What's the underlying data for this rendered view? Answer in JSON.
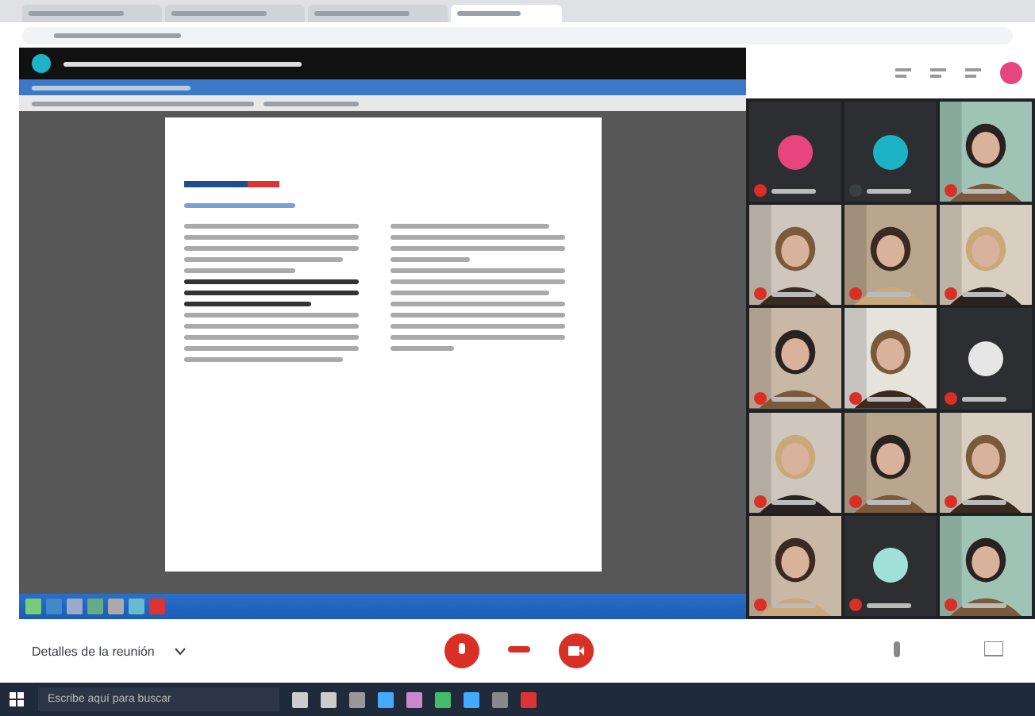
{
  "browser": {
    "tabs": [
      {
        "selected": false
      },
      {
        "selected": false
      },
      {
        "selected": false
      },
      {
        "selected": true
      }
    ]
  },
  "participants": [
    {
      "kind": "avatar",
      "color": "#e8457e",
      "muted": true
    },
    {
      "kind": "avatar",
      "color": "#1cb4c4",
      "muted": false
    },
    {
      "kind": "picture",
      "muted": true
    },
    {
      "kind": "picture",
      "muted": true
    },
    {
      "kind": "picture",
      "muted": true
    },
    {
      "kind": "picture",
      "muted": true
    },
    {
      "kind": "picture",
      "muted": true
    },
    {
      "kind": "picture",
      "muted": true
    },
    {
      "kind": "avatar",
      "color": "#e6e6e6",
      "muted": true
    },
    {
      "kind": "picture",
      "muted": true
    },
    {
      "kind": "picture",
      "muted": true
    },
    {
      "kind": "picture",
      "muted": true
    },
    {
      "kind": "picture",
      "muted": true
    },
    {
      "kind": "avatar",
      "color": "#9fe0d8",
      "muted": true
    },
    {
      "kind": "picture",
      "muted": true
    }
  ],
  "bottom_bar": {
    "details": "Detalles de la reunión",
    "mic_on": false,
    "camera_on": false
  },
  "taskbar": {
    "search_placeholder": "Escribe aquí para buscar"
  }
}
